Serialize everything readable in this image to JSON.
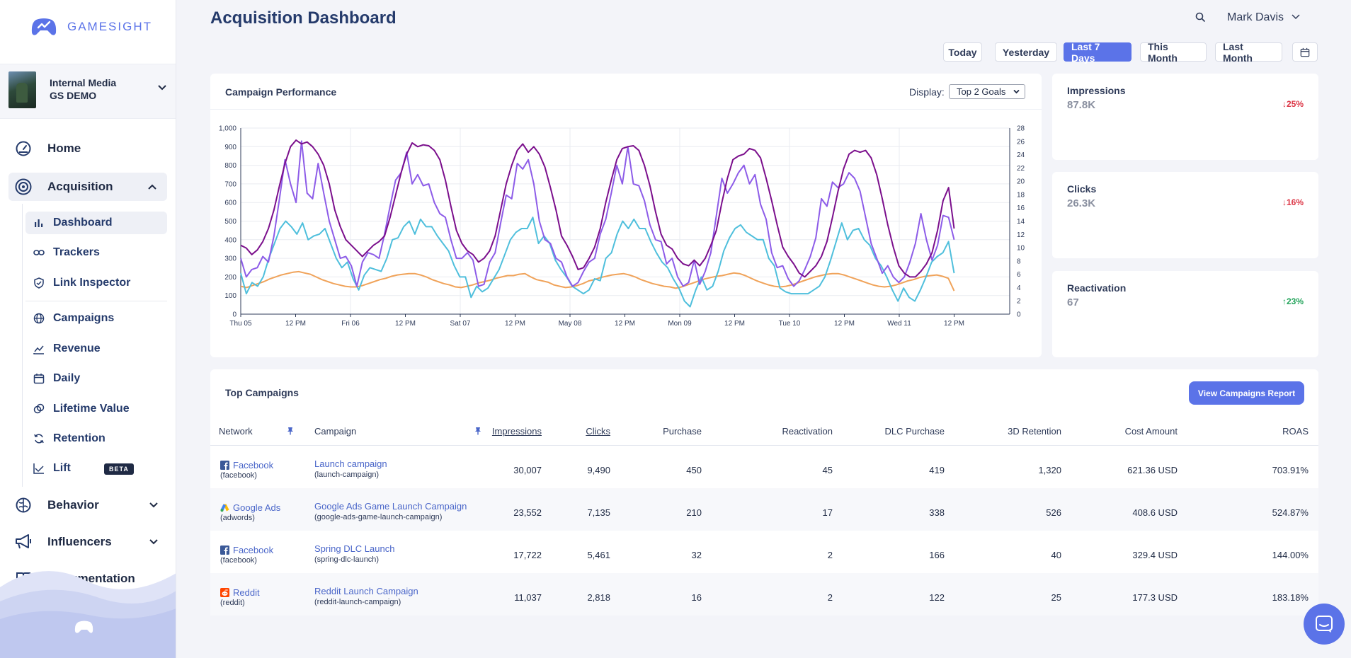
{
  "brand": {
    "name": "GAMESIGHT",
    "accent": "#5b73e8"
  },
  "org": {
    "line1": "Internal Media",
    "line2": "GS DEMO"
  },
  "nav": {
    "home": "Home",
    "acquisition": "Acquisition",
    "sub": {
      "dashboard": "Dashboard",
      "trackers": "Trackers",
      "link_inspector": "Link Inspector",
      "campaigns": "Campaigns",
      "revenue": "Revenue",
      "daily": "Daily",
      "lifetime_value": "Lifetime Value",
      "retention": "Retention",
      "lift": "Lift",
      "lift_badge": "BETA"
    },
    "behavior": "Behavior",
    "influencers": "Influencers",
    "documentation": "Documentation"
  },
  "header": {
    "title": "Acquisition Dashboard",
    "user": "Mark Davis"
  },
  "date_range": {
    "options": [
      "Today",
      "Yesterday",
      "Last 7 Days",
      "This Month",
      "Last Month"
    ],
    "selected": "Last 7 Days"
  },
  "performance": {
    "title": "Campaign Performance",
    "display_label": "Display:",
    "display_value": "Top 2 Goals"
  },
  "chart_data": {
    "type": "line",
    "x_ticks": [
      "Thu 05",
      "12 PM",
      "Fri 06",
      "12 PM",
      "Sat 07",
      "12 PM",
      "May 08",
      "12 PM",
      "Mon 09",
      "12 PM",
      "Tue 10",
      "12 PM",
      "Wed 11",
      "12 PM"
    ],
    "y_left_ticks": [
      "1,000",
      "900",
      "800",
      "700",
      "600",
      "500",
      "400",
      "300",
      "200",
      "100",
      "0"
    ],
    "y_right_ticks": [
      "28",
      "26",
      "24",
      "22",
      "20",
      "18",
      "16",
      "14",
      "12",
      "10",
      "8",
      "6",
      "4",
      "2",
      "0"
    ],
    "ylim_left": [
      0,
      1000
    ],
    "ylim_right": [
      0,
      28
    ],
    "grid": true,
    "series": [
      {
        "color": "#7b0f8c",
        "axis": "left",
        "values": [
          370,
          355,
          320,
          345,
          390,
          460,
          560,
          690,
          810,
          900,
          935,
          915,
          925,
          900,
          860,
          800,
          700,
          560,
          470,
          400,
          370,
          340,
          310,
          340,
          370,
          390,
          420,
          520,
          640,
          760,
          860,
          920,
          900,
          910,
          905,
          880,
          830,
          720,
          580,
          450,
          380,
          340,
          320,
          280,
          300,
          340,
          420,
          560,
          700,
          800,
          880,
          915,
          870,
          900,
          860,
          790,
          680,
          560,
          420,
          370,
          310,
          240,
          250,
          300,
          360,
          460,
          600,
          720,
          830,
          890,
          900,
          905,
          880,
          800,
          690,
          550,
          430,
          370,
          350,
          300,
          270,
          260,
          290,
          260,
          300,
          370,
          450,
          600,
          730,
          830,
          850,
          860,
          890,
          880,
          840,
          730,
          610,
          480,
          360,
          310,
          270,
          220,
          200,
          230,
          260,
          310,
          390,
          520,
          660,
          780,
          860,
          880,
          870,
          880,
          840,
          750,
          620,
          480,
          360,
          260,
          220,
          200,
          200,
          230,
          270,
          330,
          450,
          610,
          680,
          460
        ]
      },
      {
        "color": "#8d5ce8",
        "axis": "left",
        "values": [
          300,
          200,
          240,
          250,
          310,
          280,
          420,
          620,
          830,
          700,
          600,
          930,
          650,
          620,
          810,
          650,
          500,
          400,
          300,
          310,
          260,
          150,
          280,
          330,
          320,
          300,
          430,
          580,
          720,
          760,
          870,
          700,
          750,
          690,
          700,
          600,
          540,
          520,
          400,
          300,
          300,
          330,
          290,
          150,
          160,
          280,
          330,
          490,
          640,
          620,
          810,
          780,
          830,
          700,
          500,
          400,
          380,
          300,
          280,
          200,
          150,
          170,
          230,
          280,
          300,
          430,
          510,
          650,
          800,
          700,
          900,
          700,
          690,
          610,
          480,
          400,
          390,
          270,
          300,
          200,
          150,
          170,
          290,
          160,
          230,
          330,
          530,
          730,
          650,
          700,
          760,
          800,
          700,
          750,
          590,
          510,
          330,
          250,
          260,
          190,
          150,
          180,
          240,
          310,
          410,
          620,
          580,
          710,
          680,
          700,
          760,
          730,
          660,
          520,
          380,
          300,
          220,
          260,
          200,
          170,
          200,
          280,
          380,
          540,
          400,
          290,
          370,
          530,
          520,
          400
        ]
      },
      {
        "color": "#4fbfdc",
        "axis": "left",
        "values": [
          220,
          110,
          170,
          150,
          200,
          300,
          380,
          460,
          500,
          470,
          430,
          490,
          400,
          420,
          430,
          460,
          380,
          300,
          250,
          280,
          190,
          130,
          210,
          250,
          240,
          230,
          300,
          400,
          410,
          470,
          500,
          430,
          510,
          470,
          470,
          420,
          380,
          340,
          260,
          200,
          200,
          90,
          150,
          120,
          140,
          190,
          240,
          320,
          400,
          440,
          460,
          460,
          520,
          380,
          420,
          380,
          290,
          240,
          200,
          150,
          130,
          110,
          130,
          190,
          180,
          300,
          330,
          430,
          500,
          460,
          510,
          460,
          460,
          390,
          330,
          280,
          250,
          190,
          140,
          70,
          40,
          130,
          200,
          130,
          150,
          230,
          340,
          410,
          460,
          480,
          440,
          420,
          400,
          400,
          300,
          260,
          140,
          120,
          110,
          110,
          110,
          110,
          130,
          150,
          200,
          290,
          390,
          490,
          400,
          450,
          460,
          400,
          370,
          300,
          260,
          200,
          130,
          70,
          140,
          90,
          70,
          130,
          200,
          280,
          310,
          330,
          390,
          220
        ]
      },
      {
        "color": "#f0a35a",
        "axis": "right",
        "values": [
          4.2,
          4.0,
          4.3,
          4.6,
          4.9,
          5.3,
          5.6,
          5.9,
          6.1,
          6.3,
          6.4,
          6.2,
          6.0,
          5.6,
          5.2,
          4.9,
          4.6,
          4.4,
          4.2,
          4.1,
          4.1,
          4.3,
          4.6,
          4.9,
          5.2,
          5.4,
          5.7,
          5.9,
          6.0,
          6.1,
          6.1,
          5.9,
          5.6,
          5.2,
          4.9,
          4.6,
          4.4,
          4.1,
          4.0,
          4.2,
          4.4,
          4.7,
          4.9,
          5.1,
          5.4,
          5.6,
          5.8,
          5.8,
          6.0,
          6.1,
          5.6,
          5.2,
          5.0,
          4.8,
          4.4,
          4.2,
          4.0,
          4.1,
          4.3,
          4.6,
          5.0,
          5.2,
          5.5,
          5.7,
          5.9,
          6.0,
          6.1,
          5.9,
          5.6,
          5.2,
          4.9,
          4.6,
          4.4,
          4.2,
          4.1,
          3.9,
          4.1,
          4.4,
          4.7,
          5.0,
          5.3,
          5.5,
          5.7,
          5.8,
          6.0,
          6.2,
          6.1,
          5.8,
          5.4,
          5.0,
          4.7,
          4.4,
          4.2,
          4.1,
          4.2,
          4.4,
          4.7,
          5.0,
          5.3,
          5.6,
          5.8,
          6.0,
          6.1,
          6.1,
          5.9,
          5.6,
          5.3,
          5.0,
          4.7,
          4.4,
          4.2,
          4.1,
          4.2,
          4.4,
          4.7,
          5.0,
          5.2,
          5.5,
          5.7,
          5.8,
          5.9,
          5.7,
          5.4,
          3.5
        ]
      }
    ]
  },
  "metrics": [
    {
      "label": "Impressions",
      "value": "87.8K",
      "change": "25%",
      "direction": "down"
    },
    {
      "label": "Clicks",
      "value": "26.3K",
      "change": "16%",
      "direction": "down"
    },
    {
      "label": "Reactivation",
      "value": "67",
      "change": "23%",
      "direction": "up"
    }
  ],
  "campaigns": {
    "title": "Top Campaigns",
    "report_button": "View Campaigns Report",
    "columns": [
      "Network",
      "Campaign",
      "Impressions",
      "Clicks",
      "Purchase",
      "Reactivation",
      "DLC Purchase",
      "3D Retention",
      "Cost Amount",
      "ROAS"
    ],
    "rows": [
      {
        "network": "Facebook",
        "network_slug": "(facebook)",
        "network_icon": "facebook-icon",
        "campaign": "Launch campaign",
        "campaign_slug": "(launch-campaign)",
        "impressions": "30,007",
        "clicks": "9,490",
        "purchase": "450",
        "reactivation": "45",
        "dlc": "419",
        "retention": "1,320",
        "cost": "621.36 USD",
        "roas": "703.91%"
      },
      {
        "network": "Google Ads",
        "network_slug": "(adwords)",
        "network_icon": "google-ads-icon",
        "campaign": "Google Ads Game Launch Campaign",
        "campaign_slug": "(google-ads-game-launch-campaign)",
        "impressions": "23,552",
        "clicks": "7,135",
        "purchase": "210",
        "reactivation": "17",
        "dlc": "338",
        "retention": "526",
        "cost": "408.6 USD",
        "roas": "524.87%"
      },
      {
        "network": "Facebook",
        "network_slug": "(facebook)",
        "network_icon": "facebook-icon",
        "campaign": "Spring DLC Launch",
        "campaign_slug": "(spring-dlc-launch)",
        "impressions": "17,722",
        "clicks": "5,461",
        "purchase": "32",
        "reactivation": "2",
        "dlc": "166",
        "retention": "40",
        "cost": "329.4 USD",
        "roas": "144.00%"
      },
      {
        "network": "Reddit",
        "network_slug": "(reddit)",
        "network_icon": "reddit-icon",
        "campaign": "Reddit Launch Campaign",
        "campaign_slug": "(reddit-launch-campaign)",
        "impressions": "11,037",
        "clicks": "2,818",
        "purchase": "16",
        "reactivation": "2",
        "dlc": "122",
        "retention": "25",
        "cost": "177.3 USD",
        "roas": "183.18%"
      }
    ]
  }
}
